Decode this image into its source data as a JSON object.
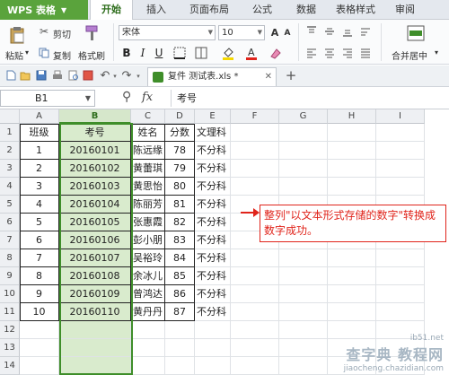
{
  "app": {
    "logo": "WPS 表格"
  },
  "menu_tabs": [
    "开始",
    "插入",
    "页面布局",
    "公式",
    "数据",
    "表格样式",
    "审阅"
  ],
  "ribbon": {
    "paste": "粘贴",
    "cut": "剪切",
    "copy": "复制",
    "format_painter": "格式刷",
    "font_name": "宋体",
    "font_size": "10",
    "merge_center": "合并居中"
  },
  "document": {
    "tab_label": "复件 测试表.xls *"
  },
  "formula_bar": {
    "cell_ref": "B1",
    "fx": "fx",
    "content": "考号"
  },
  "columns": [
    "A",
    "B",
    "C",
    "D",
    "E",
    "F",
    "G",
    "H",
    "I"
  ],
  "rows": [
    "1",
    "2",
    "3",
    "4",
    "5",
    "6",
    "7",
    "8",
    "9",
    "10",
    "11",
    "12",
    "13",
    "14"
  ],
  "table": {
    "headers": [
      "班级",
      "考号",
      "姓名",
      "分数",
      "文理科"
    ],
    "rows": [
      [
        "1",
        "20160101",
        "陈远缘",
        "78",
        "不分科"
      ],
      [
        "2",
        "20160102",
        "黄蕾琪",
        "79",
        "不分科"
      ],
      [
        "3",
        "20160103",
        "黄思怡",
        "80",
        "不分科"
      ],
      [
        "4",
        "20160104",
        "陈丽芳",
        "81",
        "不分科"
      ],
      [
        "5",
        "20160105",
        "张惠霞",
        "82",
        "不分科"
      ],
      [
        "6",
        "20160106",
        "彭小朋",
        "83",
        "不分科"
      ],
      [
        "7",
        "20160107",
        "吴裕玲",
        "84",
        "不分科"
      ],
      [
        "8",
        "20160108",
        "余冰儿",
        "85",
        "不分科"
      ],
      [
        "9",
        "20160109",
        "曾鸿达",
        "86",
        "不分科"
      ],
      [
        "10",
        "20160110",
        "黄丹丹",
        "87",
        "不分科"
      ]
    ]
  },
  "annotation": {
    "text": "整列\"以文本形式存储的数字\"转换成数字成功。"
  },
  "watermark": {
    "line1": "查字典 教程网",
    "line2": "jiaocheng.chazidian.com",
    "line3": "ib51.net"
  },
  "colors": {
    "accent": "#3f8e2a",
    "selection_fill": "#d9ebcd",
    "annotation": "#e0241b"
  }
}
